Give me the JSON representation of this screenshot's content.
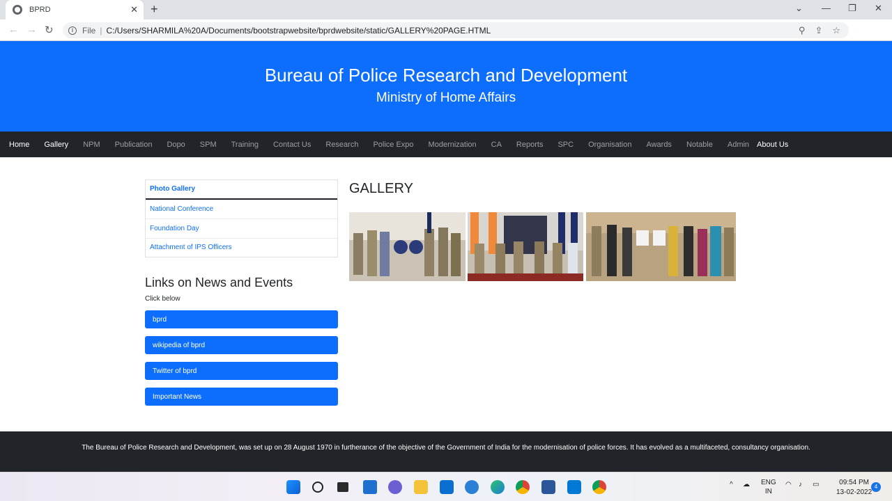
{
  "browser": {
    "tab_title": "BPRD",
    "new_tab": "+",
    "tab_close": "✕",
    "url_scheme": "File",
    "url_separator": "|",
    "url": "C:/Users/SHARMILA%20A/Documents/bootstrapwebsite/bprdwebsite/static/GALLERY%20PAGE.HTML"
  },
  "header": {
    "title": "Bureau of Police Research and Development",
    "subtitle": "Ministry of Home Affairs"
  },
  "nav": {
    "items": [
      "Home",
      "Gallery",
      "NPM",
      "Publication",
      "Dopo",
      "SPM",
      "Training",
      "Contact Us",
      "Research",
      "Police Expo",
      "Modernization",
      "CA",
      "Reports",
      "SPC",
      "Organisation",
      "Awards",
      "Notable",
      "Admin",
      "About Us"
    ]
  },
  "sidebar": {
    "list": [
      "Photo Gallery",
      "National Conference",
      "Foundation Day",
      "Attachment of IPS Officers"
    ],
    "links_title": "Links on News and Events",
    "links_subtitle": "Click below",
    "buttons": [
      "bprd",
      "wikipedia of bprd",
      "Twitter of bprd",
      "Important News"
    ]
  },
  "main": {
    "title": "GALLERY"
  },
  "footer": {
    "text": "The Bureau of Police Research and Development, was set up on 28 August 1970 in furtherance of the objective of the Government of India for the modernisation of police forces. It has evolved as a multifaceted, consultancy organisation."
  },
  "taskbar": {
    "lang": "ENG",
    "region": "IN",
    "time": "09:54 PM",
    "date": "13-02-2022",
    "notifications": "4"
  },
  "colors": {
    "primary": "#0d6efd",
    "dark": "#212529"
  }
}
